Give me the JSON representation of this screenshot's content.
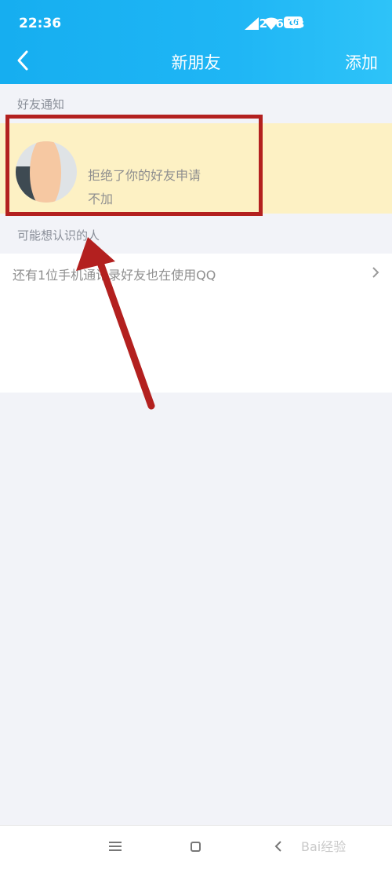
{
  "status_bar": {
    "time": "22:36",
    "net_speed": "286K/s",
    "battery": "16"
  },
  "nav": {
    "title": "新朋友",
    "add_label": "添加"
  },
  "sections": {
    "notifications": "好友通知",
    "suggested": "可能想认识的人"
  },
  "notification": {
    "message": "拒绝了你的好友申请",
    "status": "不加"
  },
  "contacts": {
    "text": "还有1位手机通讯录好友也在使用QQ"
  },
  "watermark": "Bai经验",
  "colors": {
    "header": "#16aef0",
    "highlight": "#fdf1c4",
    "annotation": "#b3201f",
    "background": "#f2f3f8"
  },
  "icons": [
    "back-icon",
    "signal-icon",
    "wifi-icon",
    "battery-icon",
    "chevron-right-icon",
    "menu-icon",
    "home-icon",
    "nav-back-icon"
  ]
}
